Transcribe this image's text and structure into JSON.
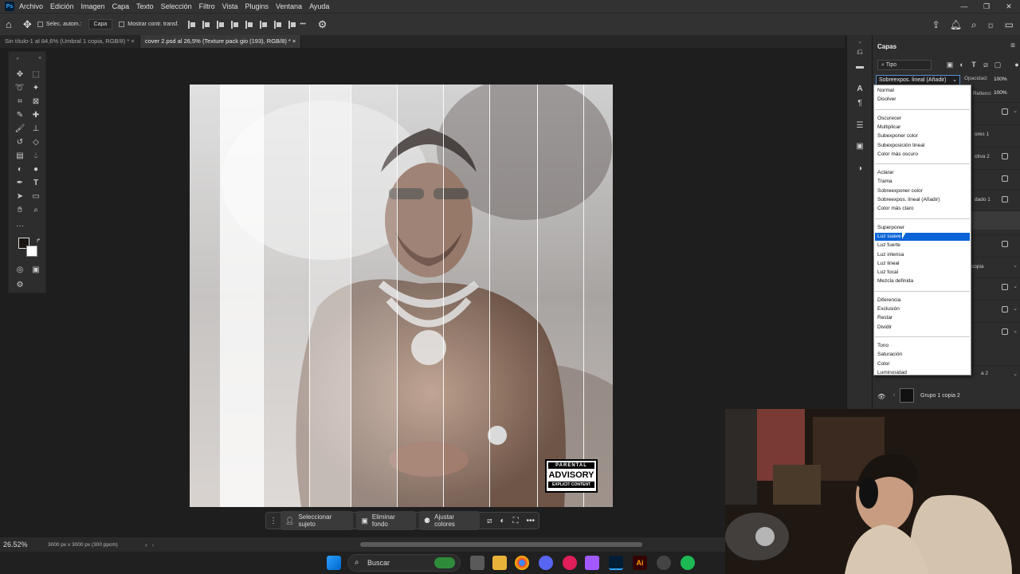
{
  "app": {
    "logo_text": "Ps"
  },
  "menubar": {
    "items": [
      "Archivo",
      "Edición",
      "Imagen",
      "Capa",
      "Texto",
      "Selección",
      "Filtro",
      "Vista",
      "Plugins",
      "Ventana",
      "Ayuda"
    ]
  },
  "window_controls": {
    "minimize": "—",
    "restore": "❐",
    "close": "✕"
  },
  "options_bar": {
    "auto_select_label": "Selec. autom.:",
    "auto_select_target": "Capa",
    "show_transform_label": "Mostrar contr. transf.",
    "more_label": "•••"
  },
  "tabs": [
    {
      "label": "Sin título-1 al 84,6% (Umbral 1 copia, RGB/8) *",
      "close": "×",
      "active": false
    },
    {
      "label": "cover 2.psd al 26,5% (Texture pack gio (193), RGB/8) *",
      "close": "×",
      "active": true
    }
  ],
  "artwork": {
    "advisory_top": "PARENTAL",
    "advisory_mid": "ADVISORY",
    "advisory_bottom": "EXPLICIT CONTENT"
  },
  "contextual_bar": {
    "select_subject": "Seleccionar sujeto",
    "remove_bg": "Eliminar fondo",
    "adjust_colors": "Ajustar colores",
    "more": "•••"
  },
  "status": {
    "zoom": "26.52%",
    "dimensions": "3000 px x 3000 px (300 ppcm)"
  },
  "layers_panel": {
    "title": "Capas",
    "filter_kind": "Tipo",
    "blend_mode": "Sobreexpos. lineal (Añadir)",
    "opacity_label": "Opacidad:",
    "opacity_value": "100%",
    "fill_label": "Relleno:",
    "fill_value": "100%",
    "partial_names": [
      "ores 1",
      "ctiva 2",
      "dado 1",
      "copia",
      "a 2"
    ],
    "last_layer": "Grupo 1 copia 2"
  },
  "blend_dropdown": {
    "groups": [
      [
        "Normal",
        "Disolver"
      ],
      [
        "Oscurecer",
        "Multiplicar",
        "Subexponer color",
        "Subexposición lineal",
        "Color más oscuro"
      ],
      [
        "Aclarar",
        "Trama",
        "Sobreexponer color",
        "Sobreexpos. lineal (Añadir)",
        "Color más claro"
      ],
      [
        "Superponer",
        "Luz suave",
        "Luz fuerte",
        "Luz intensa",
        "Luz lineal",
        "Luz focal",
        "Mezcla definida"
      ],
      [
        "Diferencia",
        "Exclusión",
        "Restar",
        "Dividir"
      ],
      [
        "Tono",
        "Saturación",
        "Color",
        "Luminosidad"
      ]
    ],
    "highlighted": "Luz suave"
  },
  "taskbar": {
    "search_placeholder": "Buscar"
  },
  "colors": {
    "accent_selected": "#0a64d8",
    "ps_blue": "#31a8ff",
    "panel_bg": "#2d2d2d"
  }
}
